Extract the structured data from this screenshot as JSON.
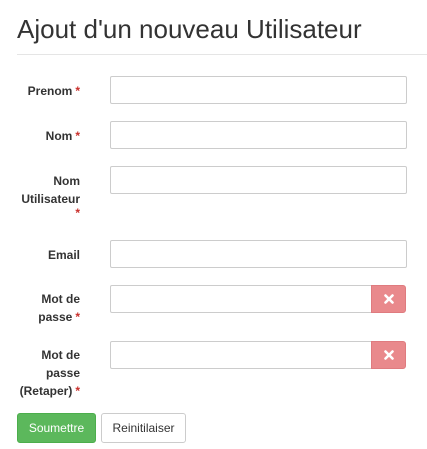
{
  "page": {
    "title": "Ajout d'un nouveau Utilisateur"
  },
  "form": {
    "required_marker": "*",
    "fields": [
      {
        "label": "Prenom",
        "value": ""
      },
      {
        "label": "Nom",
        "value": ""
      },
      {
        "label_lines": [
          "Nom",
          "Utilisateur"
        ],
        "value": ""
      },
      {
        "label": "Email",
        "value": ""
      },
      {
        "label_lines": [
          "Mot de",
          "passe"
        ],
        "value": "",
        "clear_icon": "times-icon"
      },
      {
        "label_lines": [
          "Mot de",
          "passe",
          "(Retaper)"
        ],
        "value": "",
        "clear_icon": "times-icon"
      }
    ],
    "clear_button_color": "#e9898c",
    "submit_label": "Soumettre",
    "submit_color": "#5cb85c",
    "reset_label": "Reinitilaiser"
  }
}
